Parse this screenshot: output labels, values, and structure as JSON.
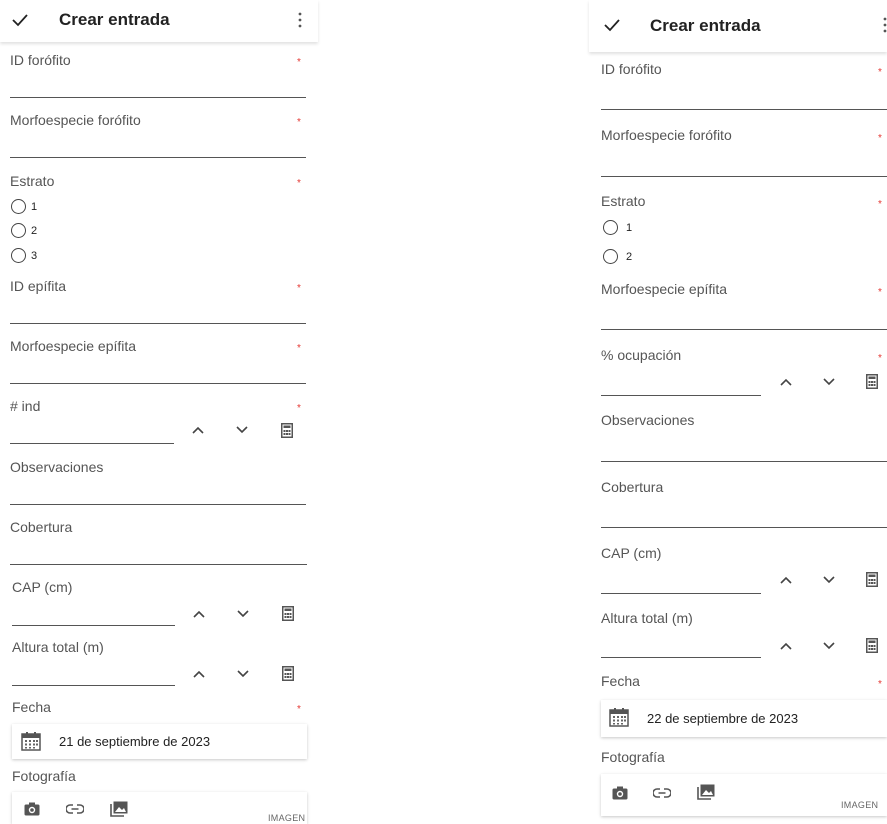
{
  "left": {
    "appbar": {
      "title": "Crear entrada"
    },
    "fields": {
      "id_forofito": "ID forófito",
      "morfo_forofito": "Morfoespecie forófito",
      "estrato": "Estrato",
      "estrato_options": [
        "1",
        "2",
        "3"
      ],
      "id_epifita": "ID epífita",
      "morfo_epifita": "Morfoespecie epífita",
      "ind": "# ind",
      "observaciones": "Observaciones",
      "cobertura": "Cobertura",
      "cap": "CAP (cm)",
      "altura": "Altura total (m)",
      "fecha": "Fecha",
      "fecha_value": "21 de septiembre de 2023",
      "fotografia": "Fotografía",
      "imagen": "IMAGEN"
    },
    "required_mark": "*"
  },
  "right": {
    "appbar": {
      "title": "Crear entrada"
    },
    "fields": {
      "id_forofito": "ID forófito",
      "morfo_forofito": "Morfoespecie forófito",
      "estrato": "Estrato",
      "estrato_options": [
        "1",
        "2"
      ],
      "morfo_epifita": "Morfoespecie epífita",
      "ocupacion": "% ocupación",
      "observaciones": "Observaciones",
      "cobertura": "Cobertura",
      "cap": "CAP (cm)",
      "altura": "Altura total (m)",
      "fecha": "Fecha",
      "fecha_value": "22 de septiembre de 2023",
      "fotografia": "Fotografía",
      "imagen": "IMAGEN"
    },
    "required_mark": "*"
  },
  "icons": {
    "check": "check-icon",
    "overflow": "more-vert-icon",
    "increment": "chevron-up-icon",
    "decrement": "chevron-down-icon",
    "calculator": "calculator-icon",
    "calendar": "calendar-icon",
    "camera": "camera-icon",
    "link": "link-icon",
    "gallery": "photo-library-icon"
  },
  "colors": {
    "required": "#e53935",
    "text": "#333333",
    "line": "#555555"
  }
}
